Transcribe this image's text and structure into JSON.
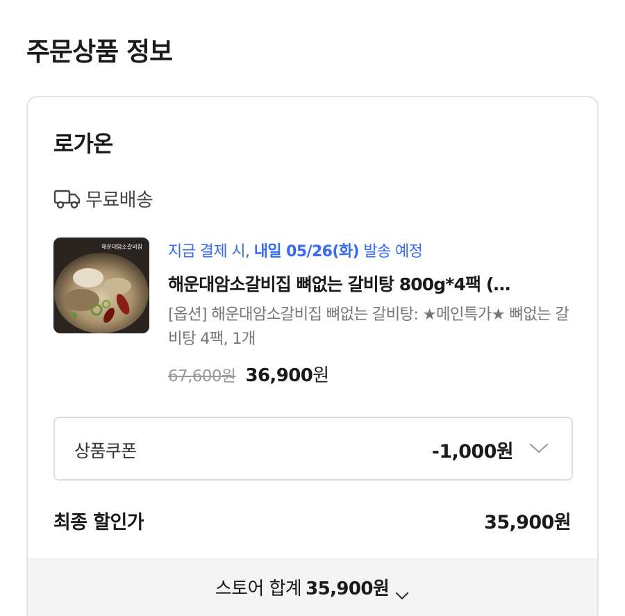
{
  "section_title": "주문상품 정보",
  "store": {
    "name": "로가온",
    "shipping_label": "무료배송"
  },
  "product": {
    "delivery_prefix": "지금 결제 시, ",
    "delivery_date": "내일 05/26(화)",
    "delivery_suffix": " 발송 예정",
    "name": "해운대암소갈비집 뼈없는 갈비탕 800g*4팩 (…",
    "option": "[옵션] 해운대암소갈비집 뼈없는 갈비탕: ★메인특가★ 뼈없는 갈비탕 4팩, 1개",
    "original_price": "67,600원",
    "sale_price_number": "36,900",
    "sale_price_unit": "원",
    "thumbnail_text": "해운대암소갈비집"
  },
  "coupon": {
    "label": "상품쿠폰",
    "value": "-1,000원"
  },
  "final": {
    "label": "최종 할인가",
    "value": "35,900원"
  },
  "footer": {
    "label": "스토어 합계",
    "total": "35,900원"
  },
  "colors": {
    "accent_blue": "#346aff",
    "card_border": "#e3e3e3",
    "footer_bg": "#f4f4f4"
  }
}
